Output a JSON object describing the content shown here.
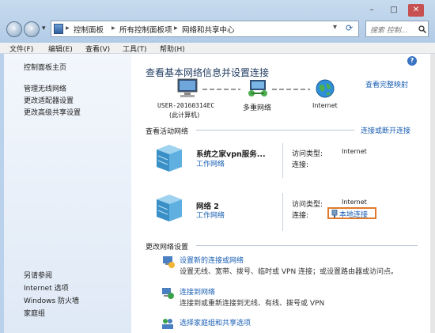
{
  "window": {
    "controls": {
      "minimize": "–",
      "maximize": "□",
      "close": "✕"
    }
  },
  "nav": {
    "back": "‹",
    "forward": "›",
    "dropdown": "▾"
  },
  "address": {
    "sep": "▸",
    "segments": [
      "控制面板",
      "所有控制面板项",
      "网络和共享中心"
    ],
    "refresh": "⟳"
  },
  "search": {
    "placeholder": "搜索 控制... ",
    "icon": "search-icon"
  },
  "menu": [
    "文件(F)",
    "编辑(E)",
    "查看(V)",
    "工具(T)",
    "帮助(H)"
  ],
  "sidebar": {
    "home": "控制面板主页",
    "items": [
      "管理无线网络",
      "更改适配器设置",
      "更改高级共享设置"
    ],
    "see_also_title": "另请参阅",
    "see_also": [
      "Internet 选项",
      "Windows 防火墙",
      "家庭组"
    ]
  },
  "main": {
    "help": "?",
    "heading": "查看基本网络信息并设置连接",
    "view_full_map": "查看完整映射",
    "map": {
      "computer": "USER-20160314EC",
      "computer_sub": "(此计算机)",
      "middle": "多重网络",
      "right": "Internet"
    },
    "active_title": "查看活动网络",
    "connect_disconnect": "连接或断开连接",
    "networks": [
      {
        "name": "系统之家vpn服务...",
        "type": "工作网络",
        "access_label": "访问类型:",
        "access_value": "Internet",
        "conn_label": "连接:",
        "conn_value": ""
      },
      {
        "name": "网络  2",
        "type": "工作网络",
        "access_label": "访问类型:",
        "access_value": "Internet",
        "conn_label": "连接:",
        "conn_value": "本地连接"
      }
    ],
    "change_title": "更改网络设置",
    "tasks": [
      {
        "title": "设置新的连接或网络",
        "desc": "设置无线、宽带、拨号、临时或 VPN 连接；或设置路由器或访问点。"
      },
      {
        "title": "连接到网络",
        "desc": "连接到或重新连接到无线、有线、拨号或 VPN"
      },
      {
        "title": "选择家庭组和共享选项",
        "desc": ""
      }
    ]
  },
  "colors": {
    "link": "#1a5fb4",
    "highlight_border": "#e07a2c"
  }
}
